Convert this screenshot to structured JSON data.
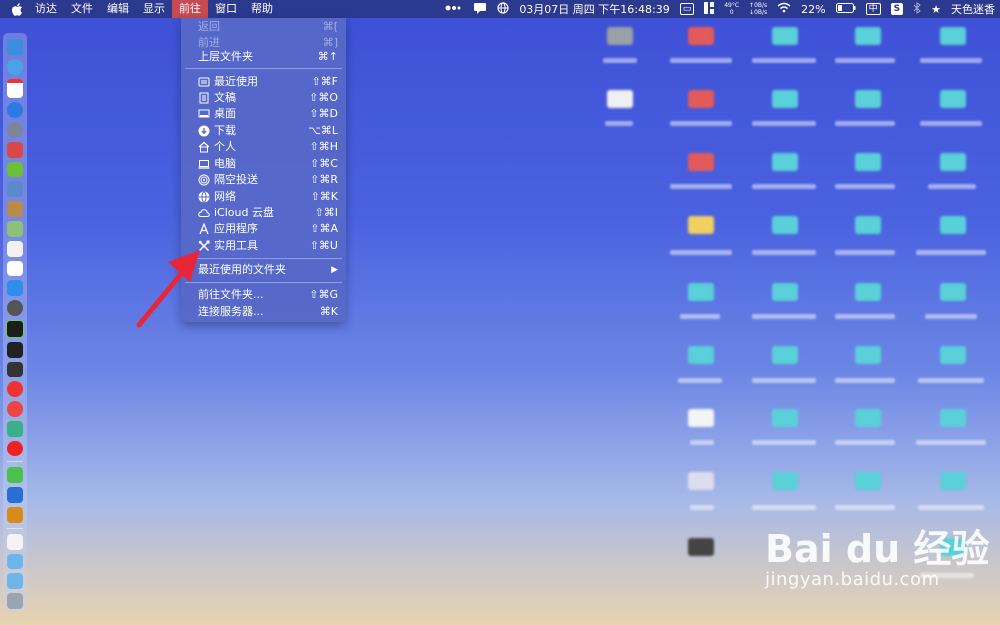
{
  "menubar": {
    "items": [
      "访达",
      "文件",
      "编辑",
      "显示",
      "前往",
      "窗口",
      "帮助"
    ],
    "active_index": 4,
    "status": {
      "temp": "49°C",
      "temp_sub": "0",
      "net_up": "0B/s",
      "net_down": "0B/s",
      "datetime": "03月07日 周四 下午16:48:39",
      "battery": "22%",
      "input_method": "中",
      "s_badge": "S",
      "user": "天色迷香"
    }
  },
  "go_menu": {
    "items": [
      {
        "label": "返回",
        "shortcut": "⌘[",
        "disabled": true,
        "icon": ""
      },
      {
        "label": "前进",
        "shortcut": "⌘]",
        "disabled": true,
        "icon": ""
      },
      {
        "label": "上层文件夹",
        "shortcut": "⌘↑",
        "disabled": false,
        "icon": ""
      },
      {
        "label": "最近使用",
        "shortcut": "⇧⌘F",
        "disabled": false,
        "icon": "recents-icon"
      },
      {
        "label": "文稿",
        "shortcut": "⇧⌘O",
        "disabled": false,
        "icon": "documents-icon"
      },
      {
        "label": "桌面",
        "shortcut": "⇧⌘D",
        "disabled": false,
        "icon": "desktop-icon"
      },
      {
        "label": "下载",
        "shortcut": "⌥⌘L",
        "disabled": false,
        "icon": "download-icon"
      },
      {
        "label": "个人",
        "shortcut": "⇧⌘H",
        "disabled": false,
        "icon": "home-icon"
      },
      {
        "label": "电脑",
        "shortcut": "⇧⌘C",
        "disabled": false,
        "icon": "computer-icon"
      },
      {
        "label": "隔空投送",
        "shortcut": "⇧⌘R",
        "disabled": false,
        "icon": "airdrop-icon"
      },
      {
        "label": "网络",
        "shortcut": "⇧⌘K",
        "disabled": false,
        "icon": "network-icon"
      },
      {
        "label": "iCloud 云盘",
        "shortcut": "⇧⌘I",
        "disabled": false,
        "icon": "icloud-icon"
      },
      {
        "label": "应用程序",
        "shortcut": "⇧⌘A",
        "disabled": false,
        "icon": "applications-icon"
      },
      {
        "label": "实用工具",
        "shortcut": "⇧⌘U",
        "disabled": false,
        "icon": "utilities-icon"
      },
      {
        "label": "最近使用的文件夹",
        "shortcut": "▶",
        "disabled": false,
        "icon": ""
      },
      {
        "label": "前往文件夹...",
        "shortcut": "⇧⌘G",
        "disabled": false,
        "icon": ""
      },
      {
        "label": "连接服务器...",
        "shortcut": "⌘K",
        "disabled": false,
        "icon": ""
      }
    ]
  },
  "watermark": {
    "logo": "Bai du 经验",
    "url": "jingyan.baidu.com"
  },
  "colors": {
    "menubar": "#2b3a8f",
    "active_menu": "#c84a52",
    "menu_bg": "#5668c8",
    "arrow": "#e8263a"
  }
}
